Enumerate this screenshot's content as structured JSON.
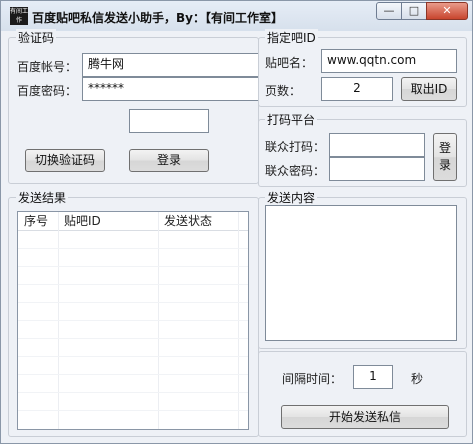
{
  "window": {
    "title": "百度贴吧私信发送小助手，By：【有间工作室】",
    "app_icon_text": "有间工作",
    "min_glyph": "—",
    "max_glyph": "□",
    "close_glyph": "✕"
  },
  "captcha_group": {
    "title": "验证码",
    "account_label": "百度帐号：",
    "account_value": "腾牛网",
    "password_label": "百度密码：",
    "password_value": "******",
    "captcha_value": "",
    "switch_button": "切换验证码",
    "login_button": "登录"
  },
  "tieba_group": {
    "title": "指定吧ID",
    "name_label": "贴吧名：",
    "name_value": "www.qqtn.com",
    "pages_label": "页数：",
    "pages_value": "2",
    "fetch_button": "取出ID"
  },
  "coding_group": {
    "title": "打码平台",
    "user_label": "联众打码：",
    "user_value": "",
    "password_label": "联众密码：",
    "password_value": "",
    "login_button": "登录"
  },
  "results_group": {
    "title": "发送结果",
    "columns": [
      "序号",
      "贴吧ID",
      "发送状态"
    ],
    "rows": []
  },
  "content_group": {
    "title": "发送内容",
    "text": ""
  },
  "interval": {
    "label": "间隔时间：",
    "value": "1",
    "unit": "秒"
  },
  "start_button": "开始发送私信"
}
